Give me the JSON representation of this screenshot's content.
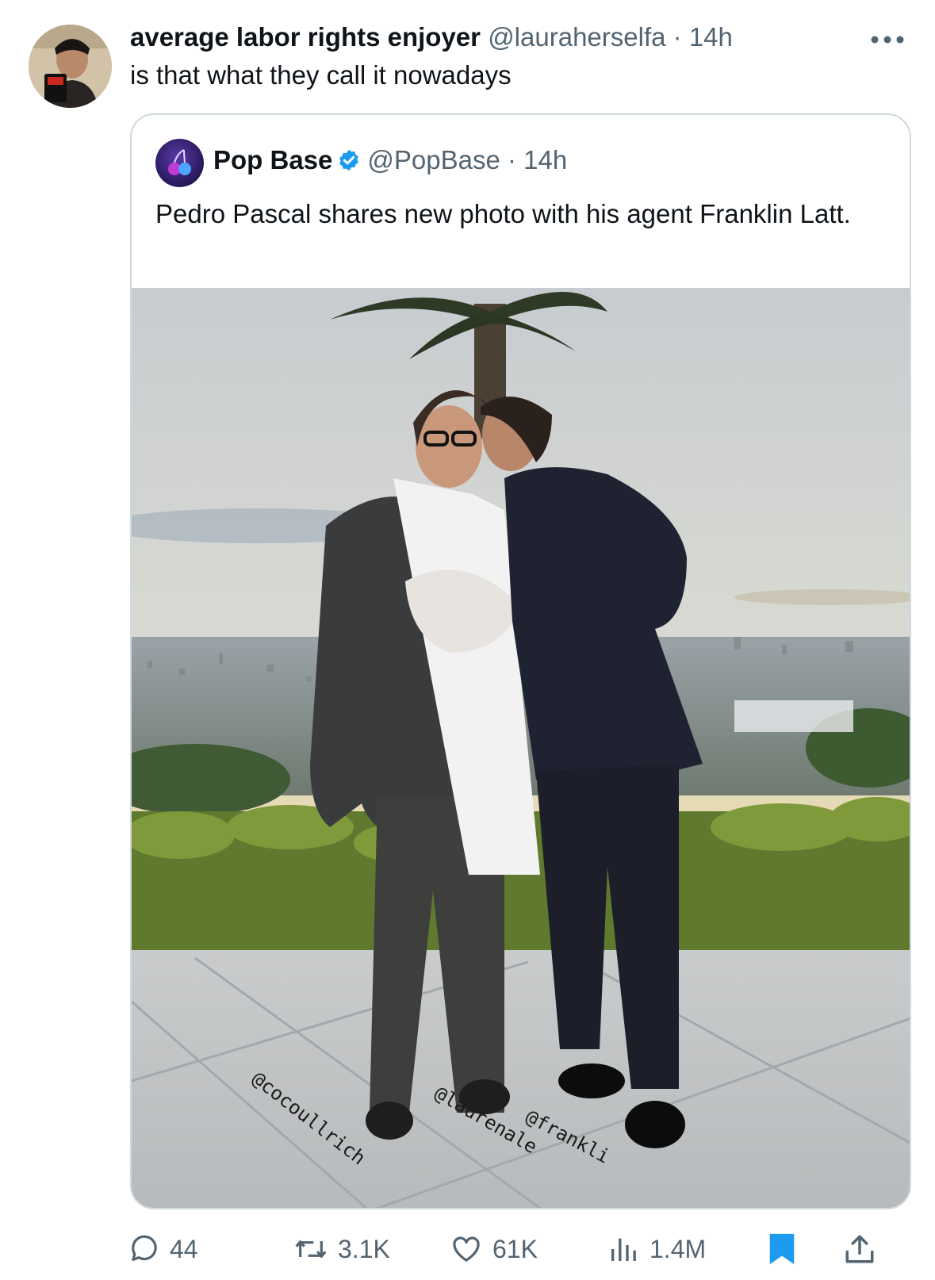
{
  "tweet": {
    "display_name": "average labor rights enjoyer",
    "handle": "@lauraherselfa",
    "separator": "·",
    "time": "14h",
    "text": "is that what they call it nowadays"
  },
  "quoted": {
    "display_name": "Pop Base",
    "handle": "@PopBase",
    "separator": "·",
    "time": "14h",
    "text": "Pedro Pascal shares new photo with his agent Franklin Latt.",
    "photo_tags": [
      "@cocoullrich",
      "@laurenale",
      "@frankli"
    ]
  },
  "actions": {
    "replies": "44",
    "reposts": "3.1K",
    "likes": "61K",
    "views": "1.4M"
  },
  "colors": {
    "text": "#0f1419",
    "secondary": "#536471",
    "border": "#cfd9de",
    "accent": "#1d9bf0"
  },
  "icons": [
    "more-icon",
    "verified-icon",
    "reply-icon",
    "repost-icon",
    "like-icon",
    "views-icon",
    "bookmark-icon",
    "share-icon"
  ]
}
